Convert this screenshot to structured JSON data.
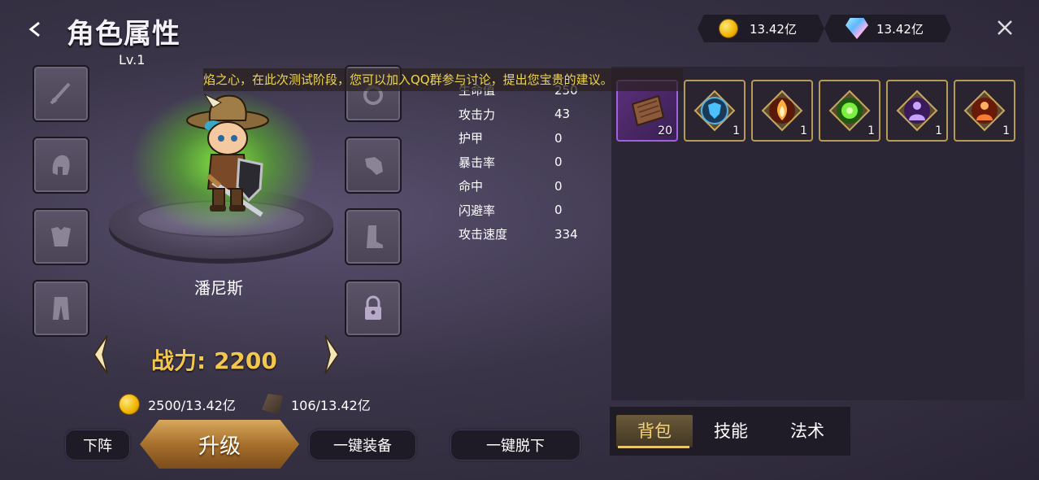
{
  "header": {
    "title": "角色属性",
    "level": "Lv.1",
    "currency": {
      "gold": "13.42亿",
      "diamond": "13.42亿"
    }
  },
  "marquee": "焰之心，在此次测试阶段，您可以加入QQ群参与讨论，提出您宝贵的建议。",
  "character": {
    "name": "潘尼斯",
    "power_label": "战力: 2200"
  },
  "equipment_slots": {
    "left": [
      "sword-icon",
      "helmet-icon",
      "armor-icon",
      "pants-icon"
    ],
    "right": [
      "ring-icon",
      "glove-icon",
      "boots-icon",
      "lock-icon"
    ]
  },
  "stats": [
    {
      "label": "生命值",
      "value": "250"
    },
    {
      "label": "攻击力",
      "value": "43"
    },
    {
      "label": "护甲",
      "value": "0"
    },
    {
      "label": "暴击率",
      "value": "0"
    },
    {
      "label": "命中",
      "value": "0"
    },
    {
      "label": "闪避率",
      "value": "0"
    },
    {
      "label": "攻击速度",
      "value": "334"
    }
  ],
  "costs": {
    "gold": "2500/13.42亿",
    "stone": "106/13.42亿"
  },
  "buttons": {
    "retire": "下阵",
    "upgrade": "升级",
    "equip_all": "一键装备",
    "unequip_all": "一键脱下"
  },
  "inventory": [
    {
      "name": "scroll-item",
      "count": "20",
      "rarity": "purple"
    },
    {
      "name": "shield-skill-item",
      "count": "1",
      "rarity": "gold"
    },
    {
      "name": "flame-skill-item",
      "count": "1",
      "rarity": "gold"
    },
    {
      "name": "green-aura-item",
      "count": "1",
      "rarity": "gold"
    },
    {
      "name": "shadow-figure-item",
      "count": "1",
      "rarity": "gold"
    },
    {
      "name": "fire-figure-item",
      "count": "1",
      "rarity": "gold"
    }
  ],
  "tabs": [
    "背包",
    "技能",
    "法术"
  ],
  "colors": {
    "accent_gold": "#f3c64d",
    "marquee_text": "#f0d64a",
    "background": "#3a3448"
  }
}
